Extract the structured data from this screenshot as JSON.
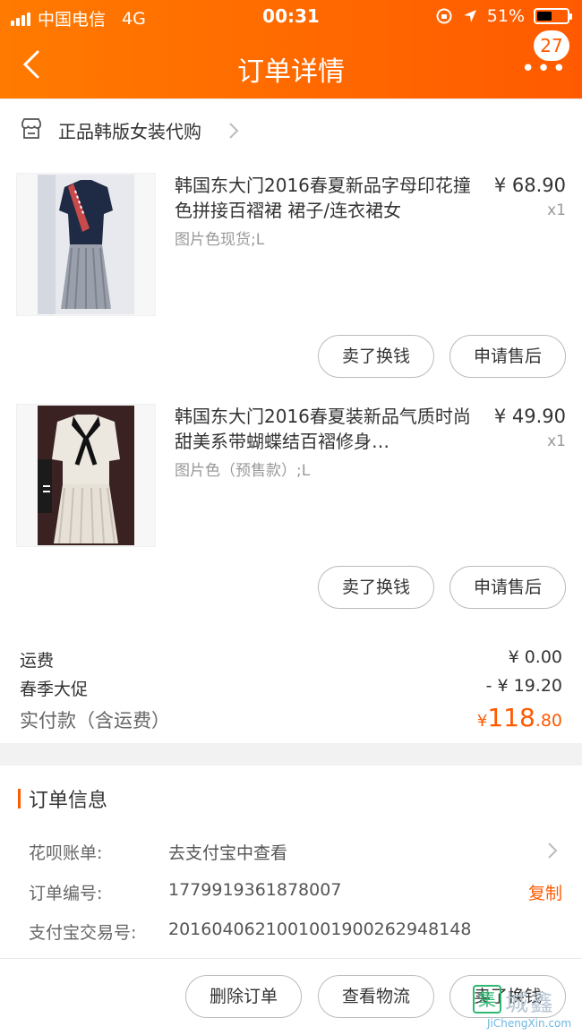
{
  "status_bar": {
    "carrier": "中国电信",
    "network": "4G",
    "time": "00:31",
    "battery": "51%",
    "battery_level": 0.51
  },
  "nav": {
    "title": "订单详情",
    "back_icon": "chevron-left-icon",
    "more_icon": "more-dots-icon",
    "badge": "27"
  },
  "shop": {
    "name": "正品韩版女装代购",
    "icon": "store-icon"
  },
  "items": [
    {
      "title": "韩国东大门2016春夏新品字母印花撞色拼接百褶裙 裙子/连衣裙女",
      "sku": "图片色现货;L",
      "price": "¥ 68.90",
      "qty": "x1",
      "btn_sell": "卖了换钱",
      "btn_after_sale": "申请售后"
    },
    {
      "title": "韩国东大门2016春夏装新品气质时尚甜美系带蝴蝶结百褶修身…",
      "sku": "图片色（预售款）;L",
      "price": "¥ 49.90",
      "qty": "x1",
      "btn_sell": "卖了换钱",
      "btn_after_sale": "申请售后"
    }
  ],
  "summary": {
    "shipping_label": "运费",
    "shipping_value": "¥ 0.00",
    "promo_label": "春季大促",
    "promo_value": "- ¥ 19.20",
    "total_label": "实付款（含运费）",
    "total_currency": "¥",
    "total_integer": "118",
    "total_decimal": ".80"
  },
  "order_info": {
    "title": "订单信息",
    "rows": [
      {
        "label": "花呗账单:",
        "value": "去支付宝中查看"
      },
      {
        "label": "订单编号:",
        "value": "1779919361878007",
        "action": "复制"
      },
      {
        "label": "支付宝交易号:",
        "value": "2016040621001001900262948148"
      }
    ]
  },
  "footer": {
    "delete_label": "删除订单",
    "logistics_label": "查看物流",
    "sell_label": "卖了换钱"
  },
  "watermark": {
    "mark": "集",
    "text": "城鑫",
    "url": "JiChengXin.com"
  },
  "colors": {
    "accent": "#ff5a00",
    "header_start": "#ff7a00",
    "header_end": "#ff5a00"
  }
}
